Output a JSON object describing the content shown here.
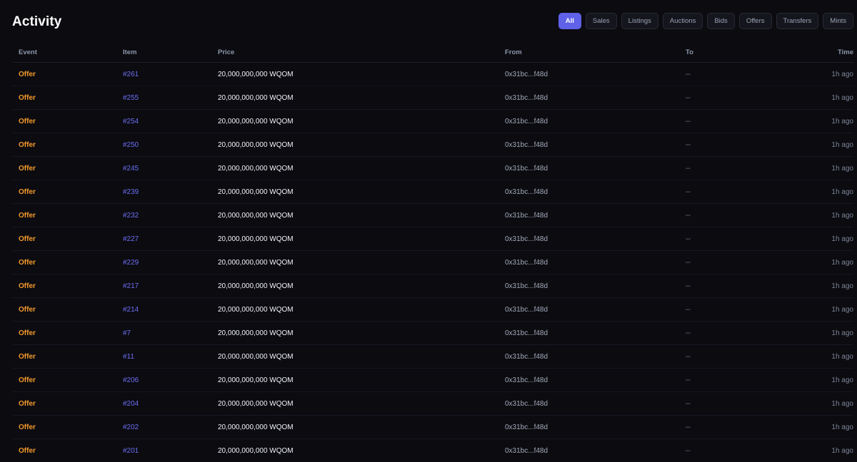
{
  "page": {
    "title": "Activity"
  },
  "filters": [
    {
      "label": "All",
      "active": true
    },
    {
      "label": "Sales",
      "active": false
    },
    {
      "label": "Listings",
      "active": false
    },
    {
      "label": "Auctions",
      "active": false
    },
    {
      "label": "Bids",
      "active": false
    },
    {
      "label": "Offers",
      "active": false
    },
    {
      "label": "Transfers",
      "active": false
    },
    {
      "label": "Mints",
      "active": false
    }
  ],
  "table": {
    "headers": {
      "event": "Event",
      "item": "Item",
      "price": "Price",
      "from": "From",
      "to": "To",
      "time": "Time"
    },
    "rows": [
      {
        "event": "Offer",
        "item": "#261",
        "price": "20,000,000,000 WQOM",
        "from": "0x31bc...f48d",
        "to": "--",
        "time": "1h ago"
      },
      {
        "event": "Offer",
        "item": "#255",
        "price": "20,000,000,000 WQOM",
        "from": "0x31bc...f48d",
        "to": "--",
        "time": "1h ago"
      },
      {
        "event": "Offer",
        "item": "#254",
        "price": "20,000,000,000 WQOM",
        "from": "0x31bc...f48d",
        "to": "--",
        "time": "1h ago"
      },
      {
        "event": "Offer",
        "item": "#250",
        "price": "20,000,000,000 WQOM",
        "from": "0x31bc...f48d",
        "to": "--",
        "time": "1h ago"
      },
      {
        "event": "Offer",
        "item": "#245",
        "price": "20,000,000,000 WQOM",
        "from": "0x31bc...f48d",
        "to": "--",
        "time": "1h ago"
      },
      {
        "event": "Offer",
        "item": "#239",
        "price": "20,000,000,000 WQOM",
        "from": "0x31bc...f48d",
        "to": "--",
        "time": "1h ago"
      },
      {
        "event": "Offer",
        "item": "#232",
        "price": "20,000,000,000 WQOM",
        "from": "0x31bc...f48d",
        "to": "--",
        "time": "1h ago"
      },
      {
        "event": "Offer",
        "item": "#227",
        "price": "20,000,000,000 WQOM",
        "from": "0x31bc...f48d",
        "to": "--",
        "time": "1h ago"
      },
      {
        "event": "Offer",
        "item": "#229",
        "price": "20,000,000,000 WQOM",
        "from": "0x31bc...f48d",
        "to": "--",
        "time": "1h ago"
      },
      {
        "event": "Offer",
        "item": "#217",
        "price": "20,000,000,000 WQOM",
        "from": "0x31bc...f48d",
        "to": "--",
        "time": "1h ago"
      },
      {
        "event": "Offer",
        "item": "#214",
        "price": "20,000,000,000 WQOM",
        "from": "0x31bc...f48d",
        "to": "--",
        "time": "1h ago"
      },
      {
        "event": "Offer",
        "item": "#7",
        "price": "20,000,000,000 WQOM",
        "from": "0x31bc...f48d",
        "to": "--",
        "time": "1h ago"
      },
      {
        "event": "Offer",
        "item": "#11",
        "price": "20,000,000,000 WQOM",
        "from": "0x31bc...f48d",
        "to": "--",
        "time": "1h ago"
      },
      {
        "event": "Offer",
        "item": "#206",
        "price": "20,000,000,000 WQOM",
        "from": "0x31bc...f48d",
        "to": "--",
        "time": "1h ago"
      },
      {
        "event": "Offer",
        "item": "#204",
        "price": "20,000,000,000 WQOM",
        "from": "0x31bc...f48d",
        "to": "--",
        "time": "1h ago"
      },
      {
        "event": "Offer",
        "item": "#202",
        "price": "20,000,000,000 WQOM",
        "from": "0x31bc...f48d",
        "to": "--",
        "time": "1h ago"
      },
      {
        "event": "Offer",
        "item": "#201",
        "price": "20,000,000,000 WQOM",
        "from": "0x31bc...f48d",
        "to": "--",
        "time": "1h ago"
      }
    ]
  },
  "colors": {
    "accent": "#5f61e8",
    "event_offer": "#f59a2c",
    "item_link": "#6d6ff2",
    "background": "#0b0b10"
  }
}
